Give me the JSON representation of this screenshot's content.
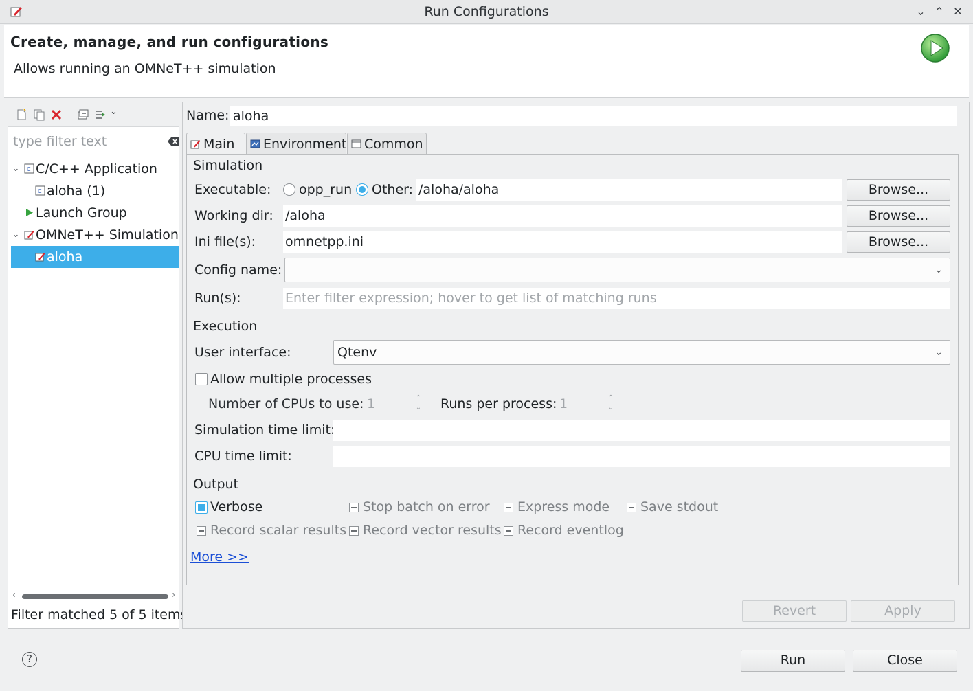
{
  "window": {
    "title": "Run Configurations"
  },
  "header": {
    "title": "Create, manage, and run configurations",
    "subtitle": "Allows running an OMNeT++ simulation"
  },
  "sidebar": {
    "filter_placeholder": "type filter text",
    "items": [
      {
        "label": "C/C++ Application"
      },
      {
        "label": "aloha (1)"
      },
      {
        "label": "Launch Group"
      },
      {
        "label": "OMNeT++ Simulation"
      },
      {
        "label": "aloha"
      }
    ],
    "status": "Filter matched 5 of 5 items"
  },
  "config": {
    "name_label": "Name:",
    "name_value": "aloha",
    "tabs": [
      {
        "label": "Main"
      },
      {
        "label": "Environment"
      },
      {
        "label": "Common"
      }
    ],
    "simulation": {
      "section": "Simulation",
      "executable_label": "Executable:",
      "opt_opp_run": "opp_run",
      "opt_other": "Other:",
      "executable_value": "/aloha/aloha",
      "working_dir_label": "Working dir:",
      "working_dir_value": "/aloha",
      "ini_label": "Ini file(s):",
      "ini_value": "omnetpp.ini",
      "config_name_label": "Config name:",
      "config_name_value": "",
      "runs_label": "Run(s):",
      "runs_placeholder": "Enter filter expression; hover to get list of matching runs",
      "browse": "Browse..."
    },
    "execution": {
      "section": "Execution",
      "ui_label": "User interface:",
      "ui_value": "Qtenv",
      "allow_multi": "Allow multiple processes",
      "cpus_label": "Number of CPUs to use:",
      "cpus_value": "1",
      "runs_per_label": "Runs per process:",
      "runs_per_value": "1",
      "sim_time_label": "Simulation time limit:",
      "cpu_time_label": "CPU time limit:"
    },
    "output": {
      "section": "Output",
      "verbose": "Verbose",
      "stop_batch": "Stop batch on error",
      "express": "Express mode",
      "save_stdout": "Save stdout",
      "record_scalar": "Record scalar results",
      "record_vector": "Record vector results",
      "record_eventlog": "Record eventlog",
      "more": "More >>"
    },
    "revert": "Revert",
    "apply": "Apply"
  },
  "footer": {
    "run": "Run",
    "close": "Close",
    "help": "?"
  },
  "colors": {
    "accent": "#3daee9",
    "link": "#1b4fd6",
    "delete": "#d9262e",
    "run_green": "#36a33e"
  }
}
